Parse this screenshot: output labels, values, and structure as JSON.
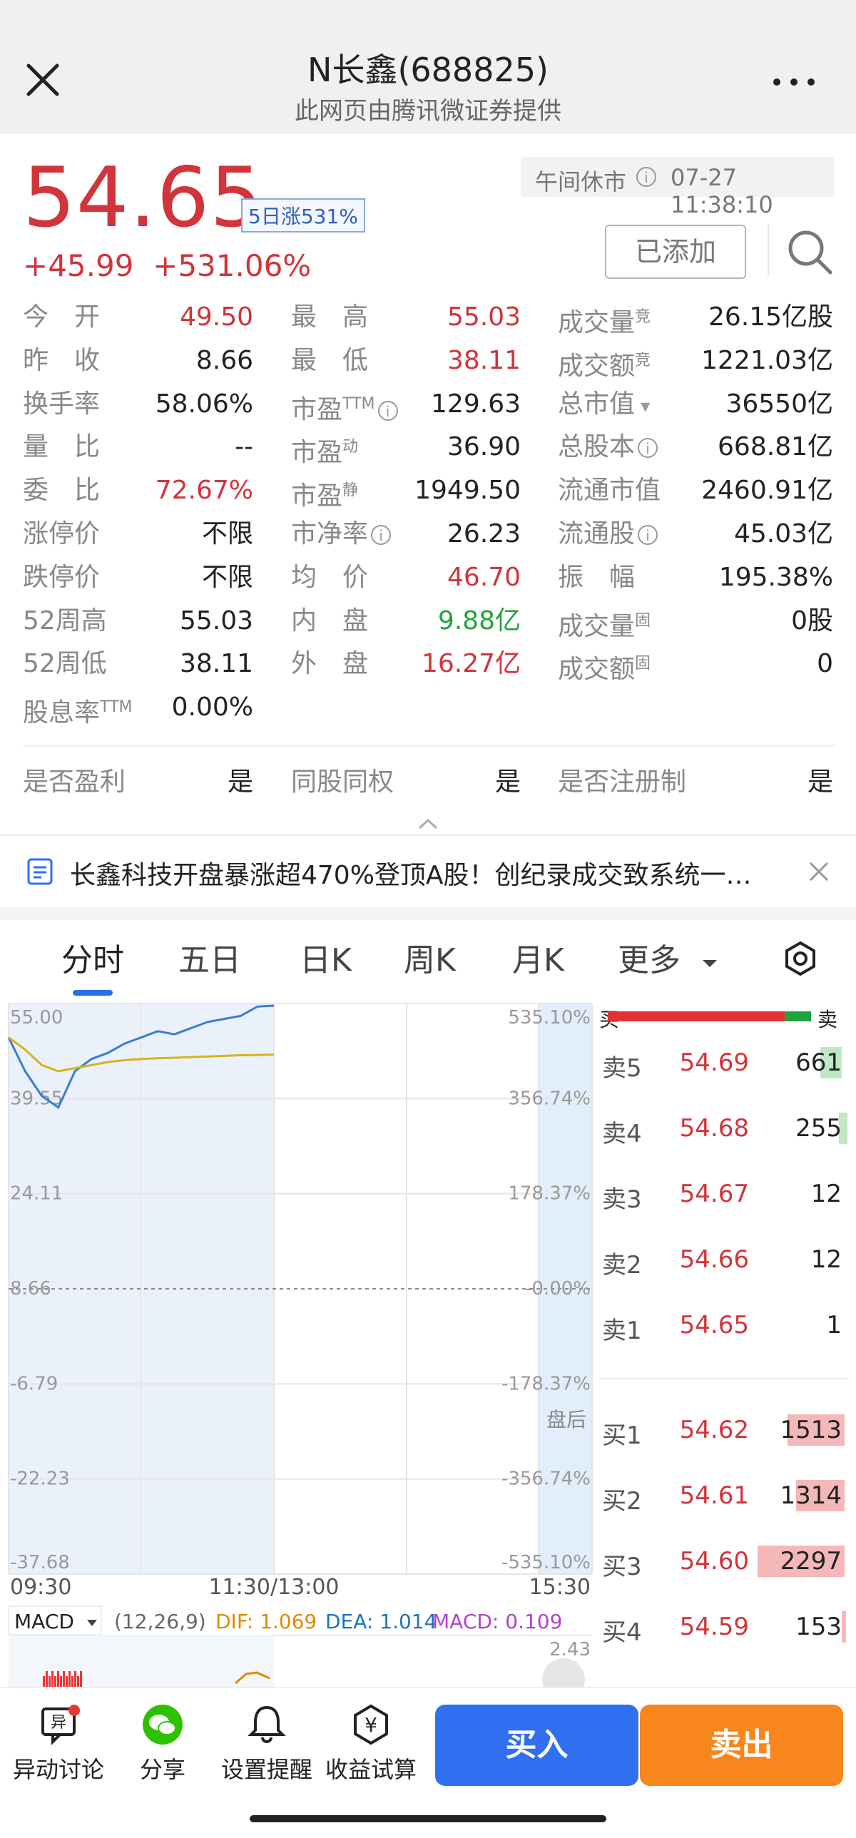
{
  "header": {
    "title": "N长鑫(688825)",
    "subtitle": "此网页由腾讯微证券提供"
  },
  "quote": {
    "price": "54.65",
    "badge": "5日涨531%",
    "change": "+45.99",
    "change_pct": "+531.06%",
    "status": "午间休市",
    "timestamp": "07-27 11:38:10",
    "added_label": "已添加"
  },
  "stats": {
    "col1": [
      {
        "label": "今　开",
        "value": "49.50"
      },
      {
        "label": "昨　收",
        "value": "8.66"
      },
      {
        "label": "换手率",
        "value": "58.06%"
      },
      {
        "label": "量　比",
        "value": "--"
      },
      {
        "label": "委　比",
        "value": "72.67%"
      },
      {
        "label": "涨停价",
        "value": "不限"
      },
      {
        "label": "跌停价",
        "value": "不限"
      },
      {
        "label": "52周高",
        "value": "55.03"
      },
      {
        "label": "52周低",
        "value": "38.11"
      },
      {
        "label": "股息率",
        "sup": "TTM",
        "value": "0.00%"
      }
    ],
    "col2": [
      {
        "label": "最　高",
        "value": "55.03"
      },
      {
        "label": "最　低",
        "value": "38.11"
      },
      {
        "label": "市盈",
        "sup": "TTM",
        "value": "129.63"
      },
      {
        "label": "市盈",
        "sup": "动",
        "value": "36.90"
      },
      {
        "label": "市盈",
        "sup": "静",
        "value": "1949.50"
      },
      {
        "label": "市净率",
        "value": "26.23"
      },
      {
        "label": "均　价",
        "value": "46.70"
      },
      {
        "label": "内　盘",
        "value": "9.88亿"
      },
      {
        "label": "外　盘",
        "value": "16.27亿"
      }
    ],
    "col3": [
      {
        "label": "成交量",
        "sup": "竞",
        "value": "26.15亿股"
      },
      {
        "label": "成交额",
        "sup": "竞",
        "value": "1221.03亿"
      },
      {
        "label": "总市值",
        "value": "36550亿"
      },
      {
        "label": "总股本",
        "value": "668.81亿"
      },
      {
        "label": "流通市值",
        "value": "2460.91亿"
      },
      {
        "label": "流通股",
        "value": "45.03亿"
      },
      {
        "label": "振　幅",
        "value": "195.38%"
      },
      {
        "label": "成交量",
        "sup": "固",
        "value": "0股"
      },
      {
        "label": "成交额",
        "sup": "固",
        "value": "0"
      }
    ],
    "flags": [
      {
        "label": "是否盈利",
        "value": "是"
      },
      {
        "label": "同股同权",
        "value": "是"
      },
      {
        "label": "是否注册制",
        "value": "是"
      }
    ]
  },
  "news": {
    "text": "长鑫科技开盘暴涨超470%登顶A股！创纪录成交致系统一…"
  },
  "tabs": [
    "分时",
    "五日",
    "日K",
    "周K",
    "月K",
    "更多"
  ],
  "chart": {
    "left_ticks": [
      "55.00",
      "39.55",
      "24.11",
      "8.66",
      "-6.79",
      "-22.23",
      "-37.68"
    ],
    "right_ticks": [
      "535.10%",
      "356.74%",
      "178.37%",
      "-0.00%",
      "-178.37%",
      "-356.74%",
      "-535.10%"
    ],
    "time_labels": [
      "09:30",
      "11:30/13:00",
      "15:30"
    ],
    "after_hours_label": "盘后",
    "macd_label": "MACD",
    "macd_params": "(12,26,9)",
    "dif": "DIF: 1.069",
    "dea": "DEA: 1.014",
    "macd": "MACD: 0.109",
    "macd_top": "2.43"
  },
  "chart_data": {
    "type": "line",
    "title": "",
    "xlabel": "",
    "ylabel": "",
    "x": [
      "09:30",
      "09:35",
      "09:40",
      "09:45",
      "09:50",
      "09:55",
      "10:00",
      "10:10",
      "10:20",
      "10:30",
      "10:40",
      "10:50",
      "11:00",
      "11:10",
      "11:20",
      "11:25",
      "11:30"
    ],
    "ylim": [
      -37.68,
      55.0
    ],
    "series": [
      {
        "color": "#3a7bd5",
        "values": [
          49.5,
          44.0,
          40.0,
          38.11,
          44.0,
          46.0,
          47.0,
          48.5,
          49.5,
          50.5,
          50.0,
          51.0,
          52.0,
          52.5,
          53.0,
          54.5,
          54.65
        ]
      },
      {
        "color": "#d9b21a",
        "values": [
          49.5,
          47.5,
          45.0,
          44.0,
          44.5,
          45.0,
          45.5,
          45.8,
          46.0,
          46.1,
          46.2,
          46.3,
          46.4,
          46.5,
          46.6,
          46.65,
          46.7
        ]
      }
    ]
  },
  "orderbook": {
    "buy_label": "买",
    "sell_label": "卖",
    "buy_ratio": 0.87,
    "asks": [
      {
        "label": "卖5",
        "price": "54.69",
        "vol": "661"
      },
      {
        "label": "卖4",
        "price": "54.68",
        "vol": "255"
      },
      {
        "label": "卖3",
        "price": "54.67",
        "vol": "12"
      },
      {
        "label": "卖2",
        "price": "54.66",
        "vol": "12"
      },
      {
        "label": "卖1",
        "price": "54.65",
        "vol": "1"
      }
    ],
    "bids": [
      {
        "label": "买1",
        "price": "54.62",
        "vol": "1513"
      },
      {
        "label": "买2",
        "price": "54.61",
        "vol": "1314"
      },
      {
        "label": "买3",
        "price": "54.60",
        "vol": "2297"
      },
      {
        "label": "买4",
        "price": "54.59",
        "vol": "153"
      }
    ]
  },
  "bottom": {
    "items": [
      {
        "label": "异动讨论",
        "icon": "discussion-icon"
      },
      {
        "label": "分享",
        "icon": "wechat-icon"
      },
      {
        "label": "设置提醒",
        "icon": "bell-icon"
      },
      {
        "label": "收益试算",
        "icon": "yen-calculator-icon"
      }
    ],
    "buy": "买入",
    "sell": "卖出"
  },
  "colors": {
    "up": "#d1343a",
    "down": "#1fa33c",
    "accent": "#2f6ff0",
    "sell_btn": "#f7861d"
  }
}
